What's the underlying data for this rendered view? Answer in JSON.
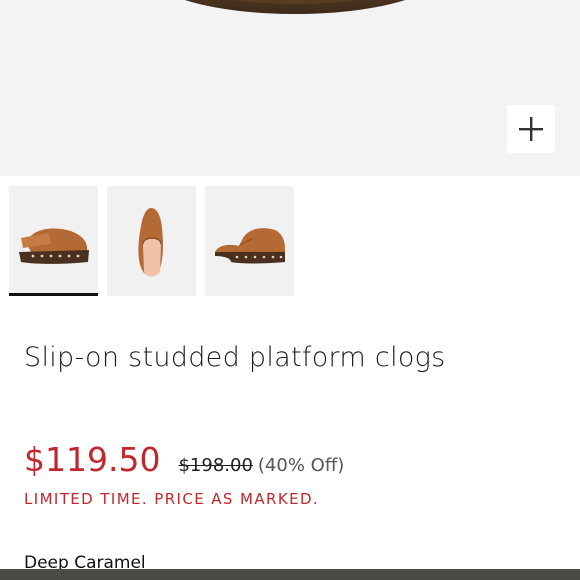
{
  "hero": {
    "zoom_icon": "plus-icon"
  },
  "thumbnails": [
    {
      "icon": "clog-side-image",
      "selected": true
    },
    {
      "icon": "clog-top-image",
      "selected": false
    },
    {
      "icon": "clog-profile-image",
      "selected": false
    }
  ],
  "product": {
    "title": "Slip-on studded platform clogs",
    "sale_price": "$119.50",
    "original_price": "$198.00",
    "discount": "(40% Off)",
    "promo": "LIMITED TIME. PRICE AS MARKED.",
    "color_name": "Deep Caramel"
  },
  "colors": {
    "sale": "#c2272d",
    "hero_background": "#f3f3f3",
    "leather": "#b46a35",
    "sole": "#4a3020"
  }
}
